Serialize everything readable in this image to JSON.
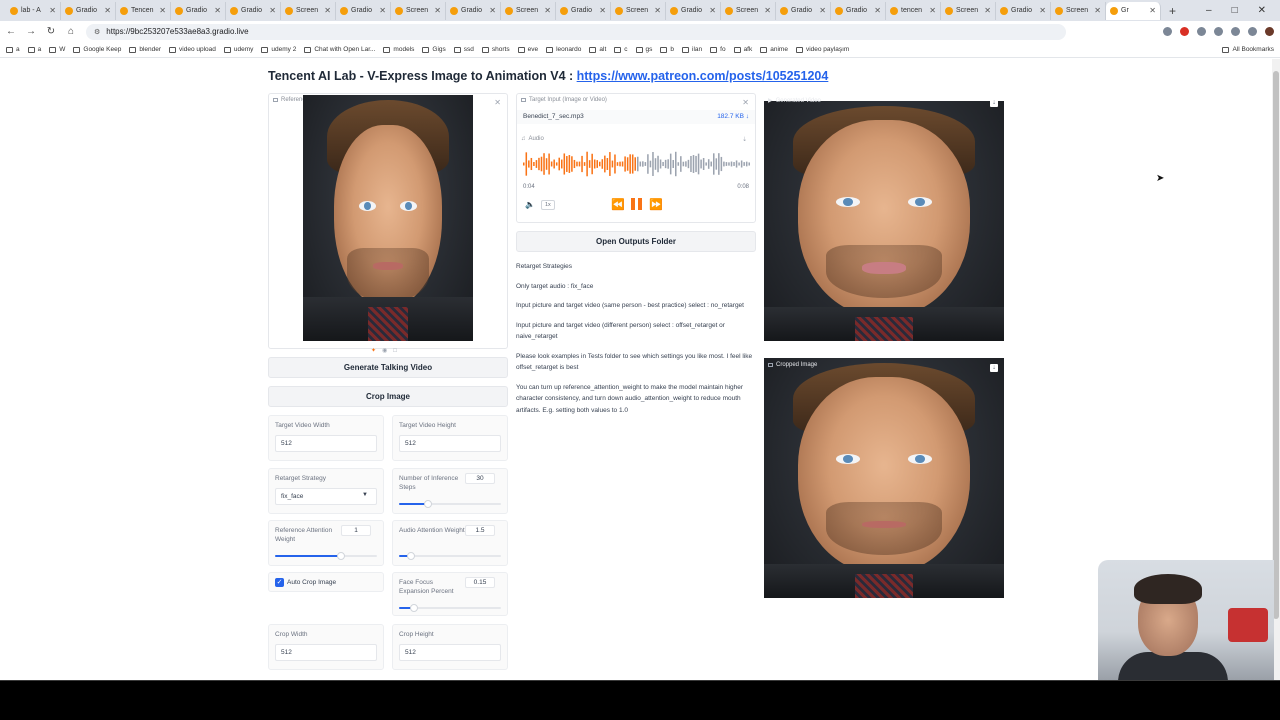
{
  "tabs": [
    {
      "label": "lab - A"
    },
    {
      "label": "Gradio"
    },
    {
      "label": "Tencen"
    },
    {
      "label": "Gradio"
    },
    {
      "label": "Gradio"
    },
    {
      "label": "Screen"
    },
    {
      "label": "Gradio"
    },
    {
      "label": "Screen"
    },
    {
      "label": "Gradio"
    },
    {
      "label": "Screen"
    },
    {
      "label": "Gradio"
    },
    {
      "label": "Screen"
    },
    {
      "label": "Gradio"
    },
    {
      "label": "Screen"
    },
    {
      "label": "Gradio"
    },
    {
      "label": "Gradio"
    },
    {
      "label": "tencen"
    },
    {
      "label": "Screen"
    },
    {
      "label": "Gradio"
    },
    {
      "label": "Screen"
    },
    {
      "label": "Gr"
    }
  ],
  "browser": {
    "url": "https://9bc253207e533ae8a3.gradio.live",
    "bookmarks": [
      "a",
      "a",
      "W",
      "Google Keep",
      "blender",
      "video upload",
      "udemy",
      "udemy 2",
      "Chat with Open Lar...",
      "models",
      "Gigs",
      "ssd",
      "shorts",
      "eve",
      "leonardo",
      "alt",
      "c",
      "gs",
      "b",
      "ilan",
      "fo",
      "afk",
      "anime",
      "video paylaşım"
    ],
    "all_bookmarks": "All Bookmarks"
  },
  "header": {
    "title": "Tencent AI Lab - V-Express Image to Animation V4 : ",
    "link": "https://www.patreon.com/posts/105251204"
  },
  "reference_image": {
    "label": "Reference Image"
  },
  "target_input": {
    "label": "Target Input (Image or Video)",
    "file_name": "Benedict_7_sec.mp3",
    "file_size": "182.7 KB ↓"
  },
  "audio": {
    "label": "Audio",
    "time_current": "0:04",
    "time_total": "0:08",
    "speed": "1x",
    "progress": 0.5
  },
  "buttons": {
    "open_outputs": "Open Outputs Folder",
    "generate": "Generate Talking Video",
    "crop": "Crop Image"
  },
  "notes": [
    "Retarget Strategies",
    "Only target audio : fix_face",
    "Input picture and target video (same person - best practice) select : no_retarget",
    "Input picture and target video (different person) select : offset_retarget or naive_retarget",
    "Please look examples in Tests folder to see which settings you like most. I feel like offset_retarget is best",
    "You can turn up reference_attention_weight to make the model maintain higher character consistency, and turn down audio_attention_weight to reduce mouth artifacts. E.g. setting both values to 1.0"
  ],
  "settings": {
    "target_width": {
      "label": "Target Video Width",
      "value": "512"
    },
    "target_height": {
      "label": "Target Video Height",
      "value": "512"
    },
    "retarget": {
      "label": "Retarget Strategy",
      "value": "fix_face"
    },
    "inference_steps": {
      "label": "Number of Inference Steps",
      "value": "30",
      "fraction": 0.28
    },
    "ref_attention": {
      "label": "Reference Attention Weight",
      "value": "1",
      "fraction": 0.65
    },
    "audio_attention": {
      "label": "Audio Attention Weight",
      "value": "1.5",
      "fraction": 0.12
    },
    "auto_crop": {
      "label": "Auto Crop Image",
      "checked": true
    },
    "face_focus": {
      "label": "Face Focus Expansion Percent",
      "value": "0.15",
      "fraction": 0.15
    },
    "crop_width": {
      "label": "Crop Width",
      "value": "512"
    },
    "crop_height": {
      "label": "Crop Height",
      "value": "512"
    }
  },
  "generated_video": {
    "label": "Generated Video"
  },
  "cropped_image": {
    "label": "Cropped Image"
  }
}
